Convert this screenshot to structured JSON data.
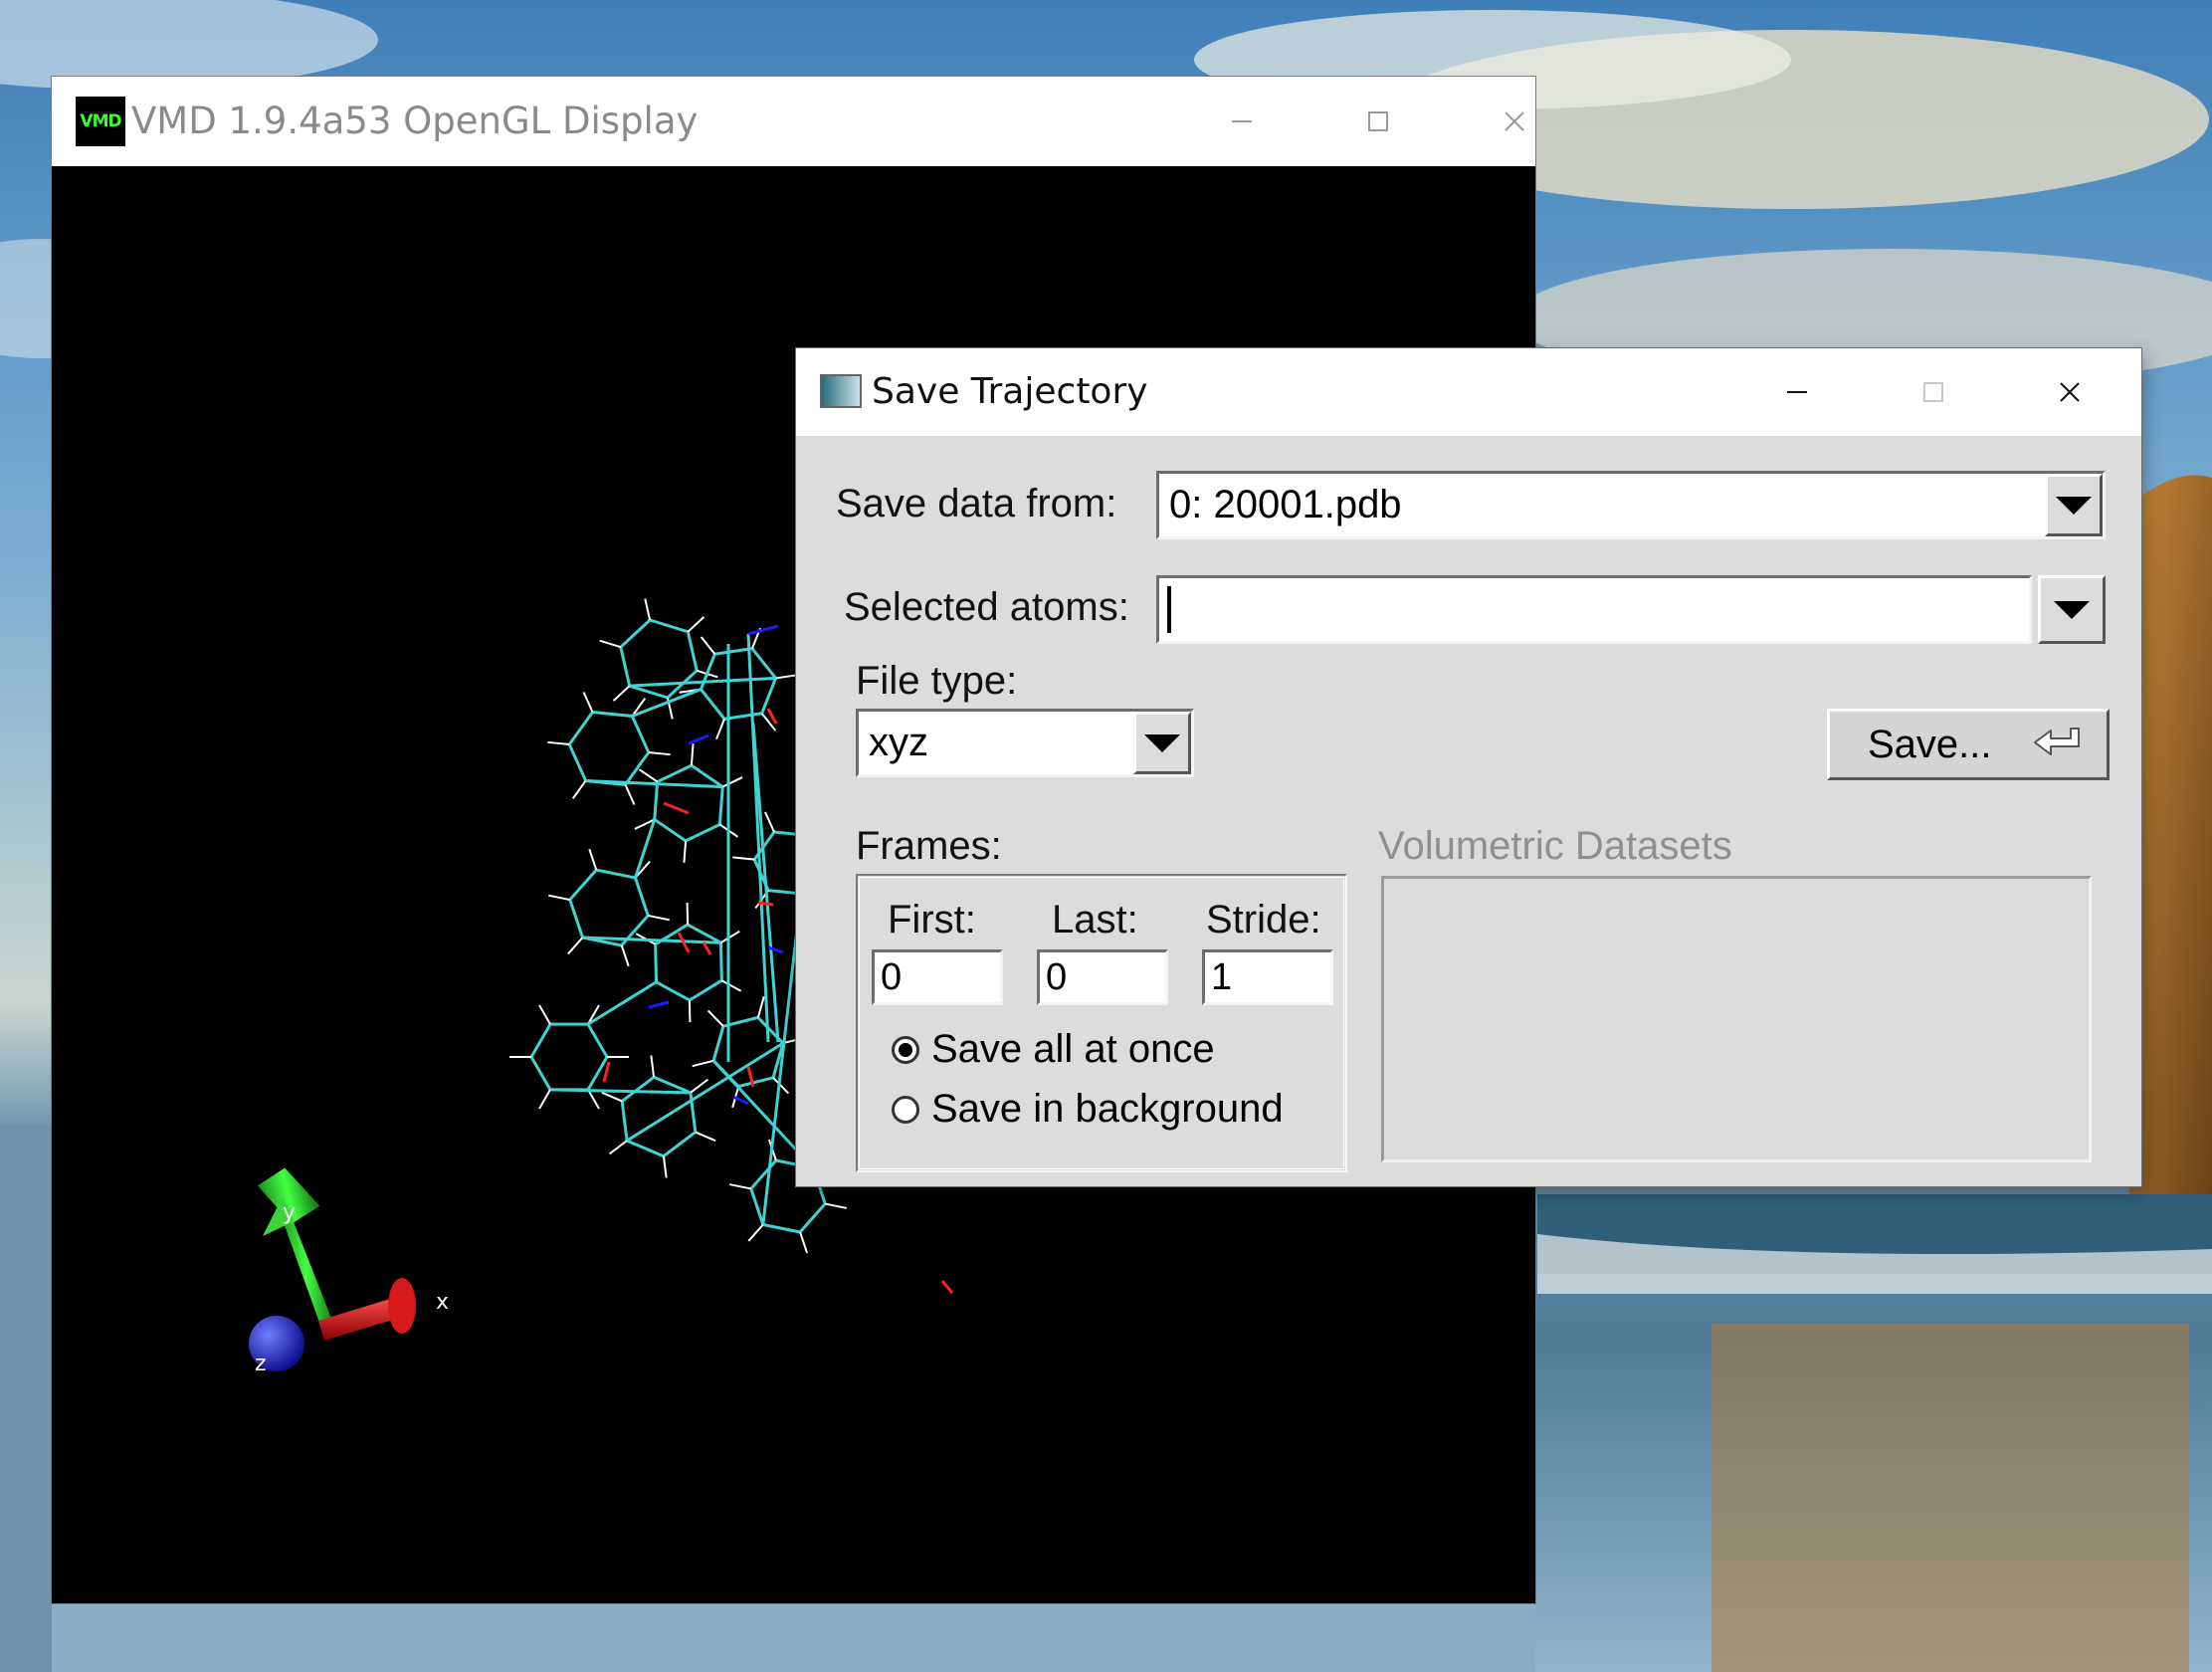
{
  "vmd_window": {
    "title": "VMD 1.9.4a53 OpenGL Display",
    "icon_text": "VMD",
    "axes": {
      "x_label": "x",
      "y_label": "y",
      "z_label": "z"
    }
  },
  "dialog": {
    "title": "Save Trajectory",
    "save_data_from": {
      "label": "Save data from:",
      "value": "0: 20001.pdb"
    },
    "selected_atoms": {
      "label": "Selected atoms:",
      "value": ""
    },
    "file_type": {
      "label": "File type:",
      "value": "xyz"
    },
    "save_button": {
      "label": "Save..."
    },
    "frames": {
      "label": "Frames:",
      "first": {
        "label": "First:",
        "value": "0"
      },
      "last": {
        "label": "Last:",
        "value": "0"
      },
      "stride": {
        "label": "Stride:",
        "value": "1"
      },
      "options": [
        {
          "label": "Save all at once",
          "selected": true
        },
        {
          "label": "Save in background",
          "selected": false
        }
      ]
    },
    "volumetric": {
      "label": "Volumetric Datasets"
    }
  },
  "colors": {
    "carbon": "#3fd3d3",
    "hydrogen": "#ffffff",
    "nitrogen": "#1a1aff",
    "oxygen": "#ff2020"
  }
}
